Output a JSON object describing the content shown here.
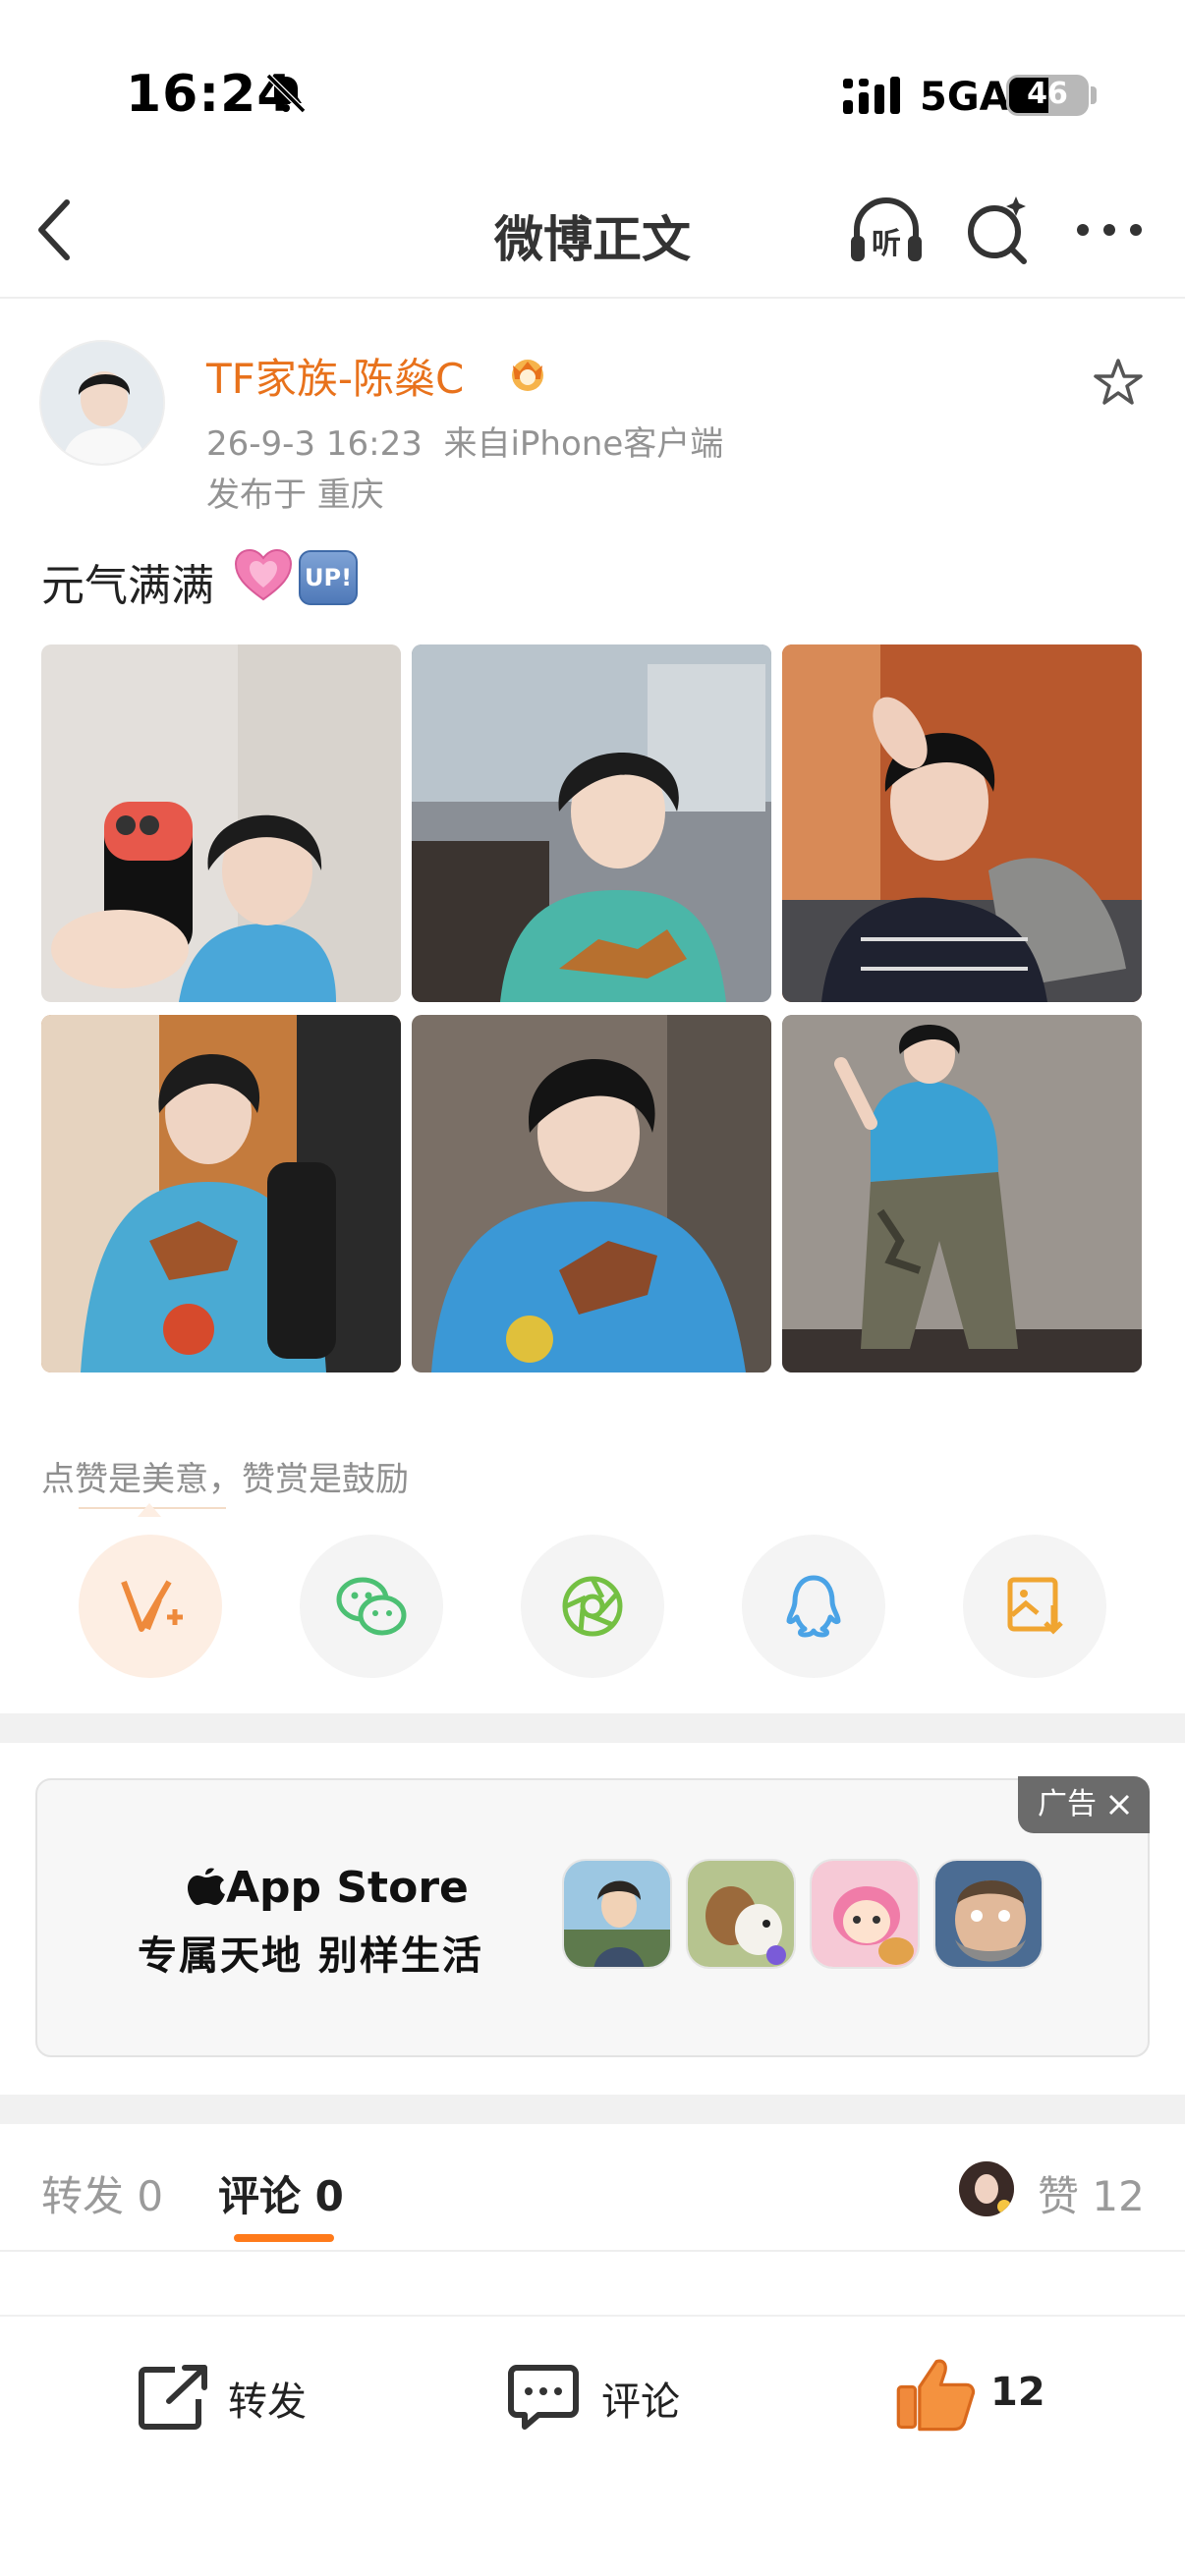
{
  "status_bar": {
    "time": "16:24",
    "network": "5GA",
    "battery": "46"
  },
  "nav": {
    "title": "微博正文",
    "listen_label": "听"
  },
  "post": {
    "author": "TF家族-陈燊C",
    "time": "26-9-3 16:23",
    "source": "来自iPhone客户端",
    "location": "发布于 重庆",
    "text": "元气满满",
    "up_badge": "UP!"
  },
  "reward_tip": "点赞是美意，赞赏是鼓励",
  "share_icons": [
    "vplus-icon",
    "wechat-icon",
    "moments-icon",
    "qq-icon",
    "save-image-icon"
  ],
  "ad": {
    "tag": "广告",
    "logo": "App Store",
    "slogan": "专属天地 别样生活"
  },
  "tabs": {
    "repost": "转发 0",
    "comment": "评论 0",
    "like": "赞 12"
  },
  "bottom_bar": {
    "repost": "转发",
    "comment": "评论",
    "like_count": "12"
  },
  "colors": {
    "accent": "#ff7a1a",
    "author": "#e8721c",
    "muted": "#939393"
  }
}
